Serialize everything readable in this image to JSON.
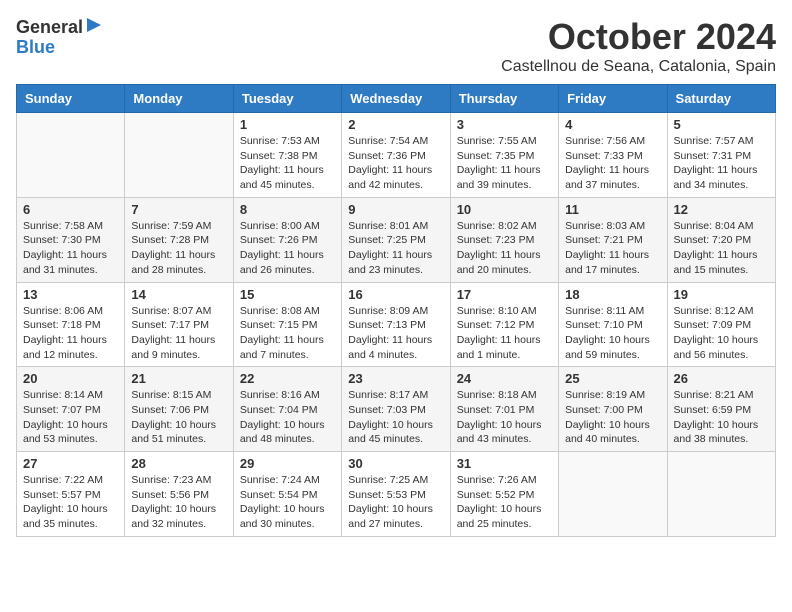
{
  "header": {
    "logo_general": "General",
    "logo_blue": "Blue",
    "month_title": "October 2024",
    "location": "Castellnou de Seana, Catalonia, Spain"
  },
  "weekdays": [
    "Sunday",
    "Monday",
    "Tuesday",
    "Wednesday",
    "Thursday",
    "Friday",
    "Saturday"
  ],
  "weeks": [
    [
      {
        "day": "",
        "info": ""
      },
      {
        "day": "",
        "info": ""
      },
      {
        "day": "1",
        "info": "Sunrise: 7:53 AM\nSunset: 7:38 PM\nDaylight: 11 hours and 45 minutes."
      },
      {
        "day": "2",
        "info": "Sunrise: 7:54 AM\nSunset: 7:36 PM\nDaylight: 11 hours and 42 minutes."
      },
      {
        "day": "3",
        "info": "Sunrise: 7:55 AM\nSunset: 7:35 PM\nDaylight: 11 hours and 39 minutes."
      },
      {
        "day": "4",
        "info": "Sunrise: 7:56 AM\nSunset: 7:33 PM\nDaylight: 11 hours and 37 minutes."
      },
      {
        "day": "5",
        "info": "Sunrise: 7:57 AM\nSunset: 7:31 PM\nDaylight: 11 hours and 34 minutes."
      }
    ],
    [
      {
        "day": "6",
        "info": "Sunrise: 7:58 AM\nSunset: 7:30 PM\nDaylight: 11 hours and 31 minutes."
      },
      {
        "day": "7",
        "info": "Sunrise: 7:59 AM\nSunset: 7:28 PM\nDaylight: 11 hours and 28 minutes."
      },
      {
        "day": "8",
        "info": "Sunrise: 8:00 AM\nSunset: 7:26 PM\nDaylight: 11 hours and 26 minutes."
      },
      {
        "day": "9",
        "info": "Sunrise: 8:01 AM\nSunset: 7:25 PM\nDaylight: 11 hours and 23 minutes."
      },
      {
        "day": "10",
        "info": "Sunrise: 8:02 AM\nSunset: 7:23 PM\nDaylight: 11 hours and 20 minutes."
      },
      {
        "day": "11",
        "info": "Sunrise: 8:03 AM\nSunset: 7:21 PM\nDaylight: 11 hours and 17 minutes."
      },
      {
        "day": "12",
        "info": "Sunrise: 8:04 AM\nSunset: 7:20 PM\nDaylight: 11 hours and 15 minutes."
      }
    ],
    [
      {
        "day": "13",
        "info": "Sunrise: 8:06 AM\nSunset: 7:18 PM\nDaylight: 11 hours and 12 minutes."
      },
      {
        "day": "14",
        "info": "Sunrise: 8:07 AM\nSunset: 7:17 PM\nDaylight: 11 hours and 9 minutes."
      },
      {
        "day": "15",
        "info": "Sunrise: 8:08 AM\nSunset: 7:15 PM\nDaylight: 11 hours and 7 minutes."
      },
      {
        "day": "16",
        "info": "Sunrise: 8:09 AM\nSunset: 7:13 PM\nDaylight: 11 hours and 4 minutes."
      },
      {
        "day": "17",
        "info": "Sunrise: 8:10 AM\nSunset: 7:12 PM\nDaylight: 11 hours and 1 minute."
      },
      {
        "day": "18",
        "info": "Sunrise: 8:11 AM\nSunset: 7:10 PM\nDaylight: 10 hours and 59 minutes."
      },
      {
        "day": "19",
        "info": "Sunrise: 8:12 AM\nSunset: 7:09 PM\nDaylight: 10 hours and 56 minutes."
      }
    ],
    [
      {
        "day": "20",
        "info": "Sunrise: 8:14 AM\nSunset: 7:07 PM\nDaylight: 10 hours and 53 minutes."
      },
      {
        "day": "21",
        "info": "Sunrise: 8:15 AM\nSunset: 7:06 PM\nDaylight: 10 hours and 51 minutes."
      },
      {
        "day": "22",
        "info": "Sunrise: 8:16 AM\nSunset: 7:04 PM\nDaylight: 10 hours and 48 minutes."
      },
      {
        "day": "23",
        "info": "Sunrise: 8:17 AM\nSunset: 7:03 PM\nDaylight: 10 hours and 45 minutes."
      },
      {
        "day": "24",
        "info": "Sunrise: 8:18 AM\nSunset: 7:01 PM\nDaylight: 10 hours and 43 minutes."
      },
      {
        "day": "25",
        "info": "Sunrise: 8:19 AM\nSunset: 7:00 PM\nDaylight: 10 hours and 40 minutes."
      },
      {
        "day": "26",
        "info": "Sunrise: 8:21 AM\nSunset: 6:59 PM\nDaylight: 10 hours and 38 minutes."
      }
    ],
    [
      {
        "day": "27",
        "info": "Sunrise: 7:22 AM\nSunset: 5:57 PM\nDaylight: 10 hours and 35 minutes."
      },
      {
        "day": "28",
        "info": "Sunrise: 7:23 AM\nSunset: 5:56 PM\nDaylight: 10 hours and 32 minutes."
      },
      {
        "day": "29",
        "info": "Sunrise: 7:24 AM\nSunset: 5:54 PM\nDaylight: 10 hours and 30 minutes."
      },
      {
        "day": "30",
        "info": "Sunrise: 7:25 AM\nSunset: 5:53 PM\nDaylight: 10 hours and 27 minutes."
      },
      {
        "day": "31",
        "info": "Sunrise: 7:26 AM\nSunset: 5:52 PM\nDaylight: 10 hours and 25 minutes."
      },
      {
        "day": "",
        "info": ""
      },
      {
        "day": "",
        "info": ""
      }
    ]
  ]
}
